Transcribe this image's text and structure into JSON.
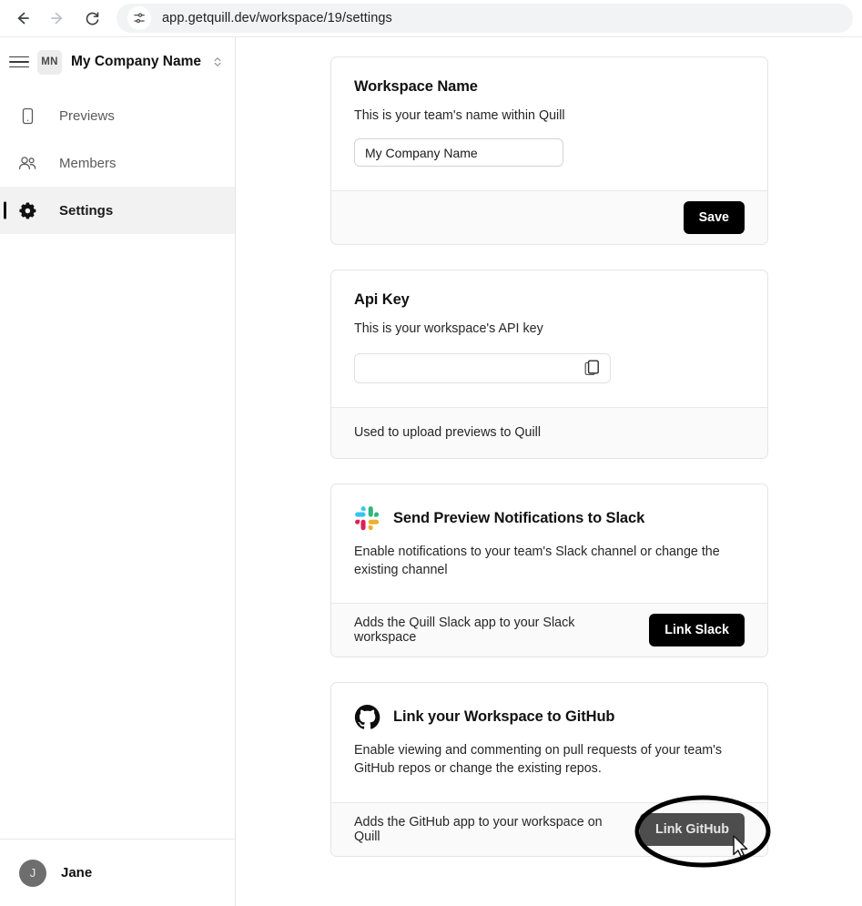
{
  "browser": {
    "url": "app.getquill.dev/workspace/19/settings",
    "back_label": "Back",
    "forward_label": "Forward",
    "reload_label": "Reload",
    "site_info_label": "View site information"
  },
  "sidebar": {
    "menu_label": "Toggle sidebar",
    "workspace": {
      "initials": "MN",
      "name": "My Company Name",
      "switcher_label": "Switch workspace"
    },
    "items": [
      {
        "label": "Previews",
        "icon": "device-icon",
        "active": false
      },
      {
        "label": "Members",
        "icon": "people-icon",
        "active": false
      },
      {
        "label": "Settings",
        "icon": "gear-icon",
        "active": true
      }
    ],
    "user": {
      "initial": "J",
      "name": "Jane"
    }
  },
  "main": {
    "cards": [
      {
        "id": "workspace-name",
        "title": "Workspace Name",
        "description": "This is your team's name within Quill",
        "input_value": "My Company Name",
        "input_placeholder": "My Company Name",
        "footer_note": "",
        "button_label": "Save"
      },
      {
        "id": "api-key",
        "title": "Api Key",
        "description": "This is your workspace's API key",
        "input_value": "",
        "input_placeholder": "",
        "copy_label": "Copy API key",
        "footer_note": "Used to upload previews to Quill",
        "button_label": ""
      },
      {
        "id": "slack",
        "icon": "slack-icon",
        "title": "Send Preview Notifications to Slack",
        "description": "Enable notifications to your team's Slack channel or change the existing channel",
        "footer_note": "Adds the Quill Slack app to your Slack workspace",
        "button_label": "Link Slack"
      },
      {
        "id": "github",
        "icon": "github-icon",
        "title": "Link your Workspace to GitHub",
        "description": "Enable viewing and commenting on pull requests of your team's GitHub repos or change the existing repos.",
        "footer_note": "Adds the GitHub app to your workspace on Quill",
        "button_label": "Link GitHub"
      }
    ]
  },
  "colors": {
    "accent": "#000000",
    "button_hover": "#4d4d4d",
    "sidebar_active": "#f2f2f2",
    "card_border": "#e4e4e4",
    "footer_bg": "#fafafa",
    "slack_green": "#2EB67D",
    "slack_blue": "#36C5F0",
    "slack_red": "#E01E5A",
    "slack_yellow": "#ECB22E",
    "annotation": "#000000"
  }
}
